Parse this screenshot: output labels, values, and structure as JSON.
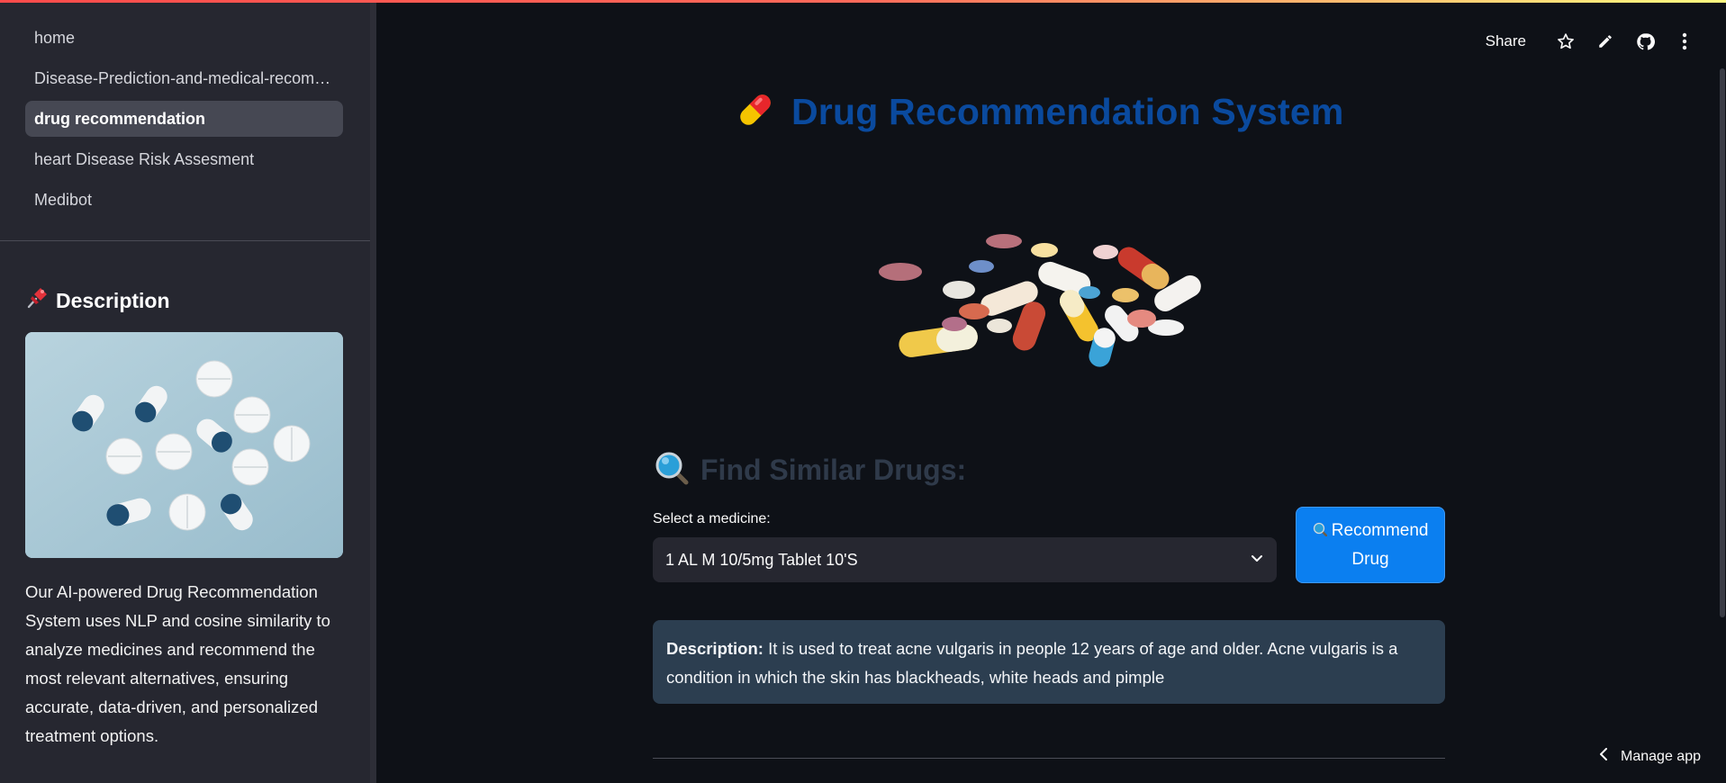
{
  "sidebar": {
    "nav": [
      {
        "label": "home",
        "active": false
      },
      {
        "label": "Disease-Prediction-and-medical-recommendation",
        "active": false
      },
      {
        "label": "drug recommendation",
        "active": true
      },
      {
        "label": "heart Disease Risk Assesment",
        "active": false
      },
      {
        "label": "Medibot",
        "active": false
      }
    ],
    "description_heading": "Description",
    "description_heading_icon": "pushpin-icon",
    "description_text": "Our AI-powered Drug Recommendation System uses NLP and cosine similarity to analyze medicines and recommend the most relevant alternatives, ensuring accurate, data-driven, and personalized treatment options."
  },
  "header": {
    "share_label": "Share",
    "icons": [
      "star-icon",
      "pencil-icon",
      "github-icon",
      "more-vertical-icon"
    ]
  },
  "main": {
    "title": "Drug Recommendation System",
    "title_icon": "pill-icon",
    "section_heading": "Find Similar Drugs:",
    "section_icon": "magnifier-icon",
    "select_label": "Select a medicine:",
    "select_value": "1 AL M 10/5mg Tablet 10'S",
    "button_line1": "Recommend",
    "button_line2": "Drug",
    "description_label": "Description:",
    "description_text": "It is used to treat acne vulgaris in people 12 years of age and older. Acne vulgaris is a condition in which the skin has blackheads, white heads and pimple"
  },
  "footer": {
    "manage_label": "Manage app"
  },
  "colors": {
    "background": "#0e1117",
    "sidebar": "#262730",
    "title": "#0a4a9e",
    "button": "#0b7ff0",
    "description_box": "#2c3e50"
  }
}
